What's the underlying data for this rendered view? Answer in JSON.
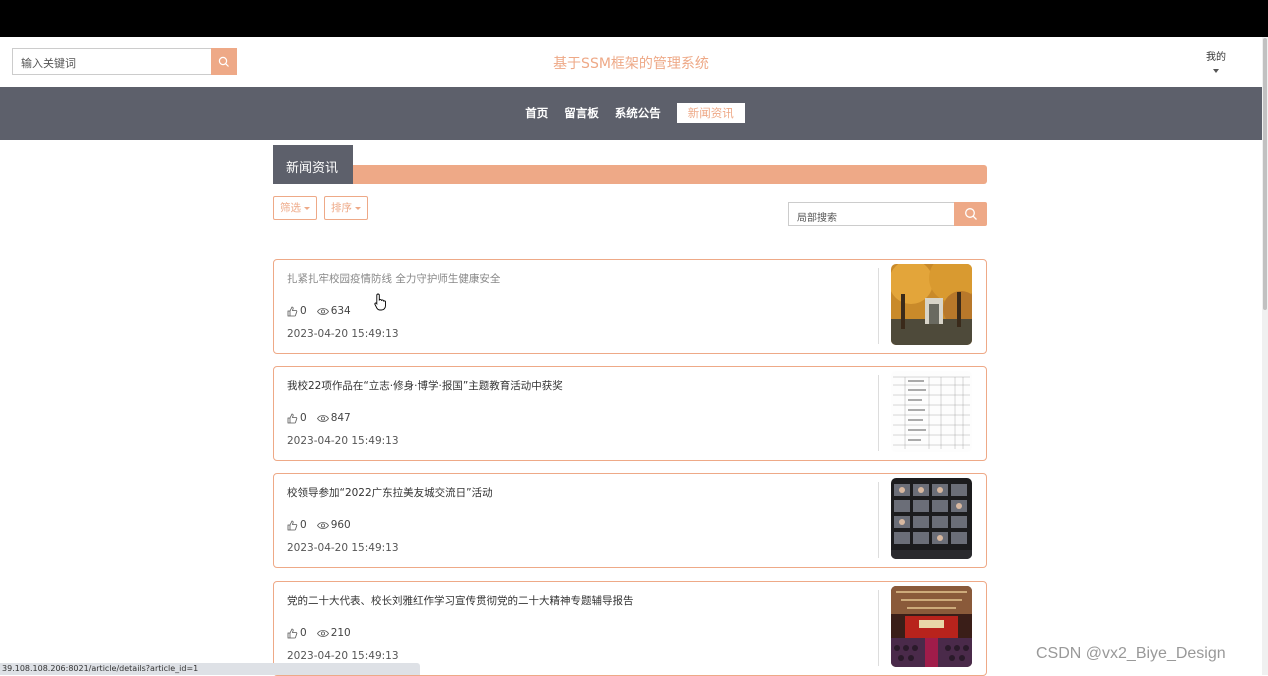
{
  "header": {
    "search_placeholder": "输入关键词",
    "site_title": "基于SSM框架的管理系统",
    "user_label": "我的"
  },
  "nav": {
    "items": [
      {
        "label": "首页"
      },
      {
        "label": "留言板"
      },
      {
        "label": "系统公告"
      },
      {
        "label": "新闻资讯",
        "active": true
      }
    ]
  },
  "section": {
    "title": "新闻资讯",
    "filter_label": "筛选",
    "sort_label": "排序",
    "local_search_placeholder": "局部搜索"
  },
  "articles": [
    {
      "title": "扎紧扎牢校园疫情防线 全力守护师生健康安全",
      "likes": "0",
      "views": "634",
      "date": "2023-04-20 15:49:13",
      "thumb": "autumn-campus-photo"
    },
    {
      "title": "我校22项作品在“立志·修身·博学·报国”主题教育活动中获奖",
      "likes": "0",
      "views": "847",
      "date": "2023-04-20 15:49:13",
      "thumb": "document-table-photo"
    },
    {
      "title": "校领导参加“2022广东拉美友城交流日”活动",
      "likes": "0",
      "views": "960",
      "date": "2023-04-20 15:49:13",
      "thumb": "video-conference-photo"
    },
    {
      "title": "党的二十大代表、校长刘雅红作学习宣传贯彻党的二十大精神专题辅导报告",
      "likes": "0",
      "views": "210",
      "date": "2023-04-20 15:49:13",
      "thumb": "auditorium-stage-photo"
    }
  ],
  "statusbar": {
    "url": "39.108.108.206:8021/article/details?article_id=1"
  },
  "watermark": "CSDN @vx2_Biye_Design",
  "colors": {
    "accent": "#eea987",
    "nav_bg": "#5d606b"
  }
}
